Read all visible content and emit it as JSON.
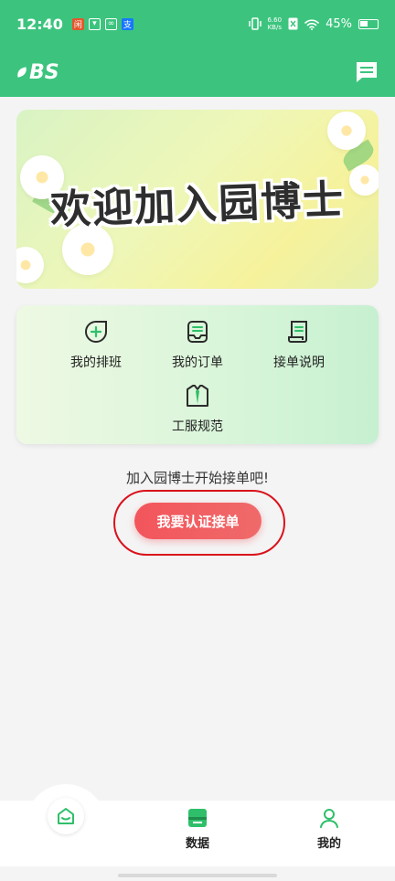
{
  "status_bar": {
    "time": "12:40",
    "net_speed_value": "6.60",
    "net_speed_unit": "KB/s",
    "battery": "45%"
  },
  "colors": {
    "brand": "#3cc47e",
    "accent_button": "#f2555c",
    "annotation": "#d9121c"
  },
  "header": {
    "logo_text": "BS",
    "message_icon": "message-icon"
  },
  "banner": {
    "title": "欢迎加入园博士"
  },
  "menu": {
    "items": [
      {
        "label": "我的排班",
        "icon": "schedule-icon"
      },
      {
        "label": "我的订单",
        "icon": "order-icon"
      },
      {
        "label": "接单说明",
        "icon": "document-icon"
      },
      {
        "label": "工服规范",
        "icon": "uniform-icon"
      }
    ]
  },
  "main": {
    "prompt": "加入园博士开始接单吧!",
    "cert_button": "我要认证接单"
  },
  "tabbar": {
    "items": [
      {
        "label": "",
        "icon": "home-icon"
      },
      {
        "label": "数据",
        "icon": "data-icon"
      },
      {
        "label": "我的",
        "icon": "user-icon"
      }
    ]
  }
}
